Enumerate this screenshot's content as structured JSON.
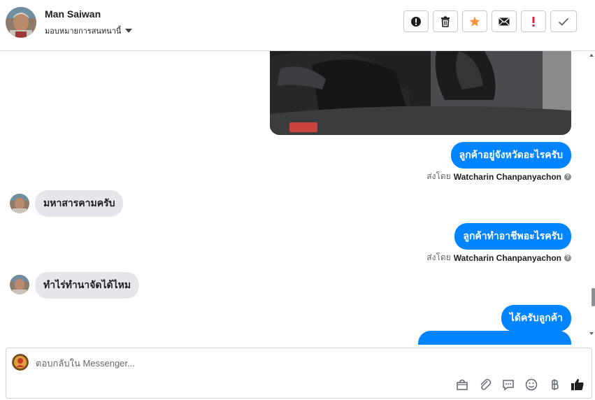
{
  "header": {
    "contact_name": "Man Saiwan",
    "assign_label": "มอบหมายการสนทนานี้",
    "actions": [
      {
        "icon": "alert-circle-icon"
      },
      {
        "icon": "trash-icon"
      },
      {
        "icon": "star-icon"
      },
      {
        "icon": "envelope-icon"
      },
      {
        "icon": "exclamation-icon"
      },
      {
        "icon": "checkmark-icon"
      }
    ]
  },
  "messages": [
    {
      "direction": "out",
      "text": "ลูกค้าอยู่จังหวัดอะไรครับ",
      "sent_prefix": "ส่งโดย",
      "sent_by": "Watcharin Chanpanyachon"
    },
    {
      "direction": "in",
      "text": "มหาสารคามครับ"
    },
    {
      "direction": "out",
      "text": "ลูกค้าทำอาชีพอะไรครับ",
      "sent_prefix": "ส่งโดย",
      "sent_by": "Watcharin Chanpanyachon"
    },
    {
      "direction": "in",
      "text": "ทำไร่ทำนาจัดได้ไหม"
    },
    {
      "direction": "out",
      "text": "ได้ครับลูกค้า"
    }
  ],
  "composer": {
    "placeholder": "ตอบกลับใน Messenger..."
  },
  "colors": {
    "outgoing_bubble": "#0084ff",
    "incoming_bubble": "#e4e6eb",
    "star": "#f7923a",
    "exclamation": "#e41e3f"
  }
}
